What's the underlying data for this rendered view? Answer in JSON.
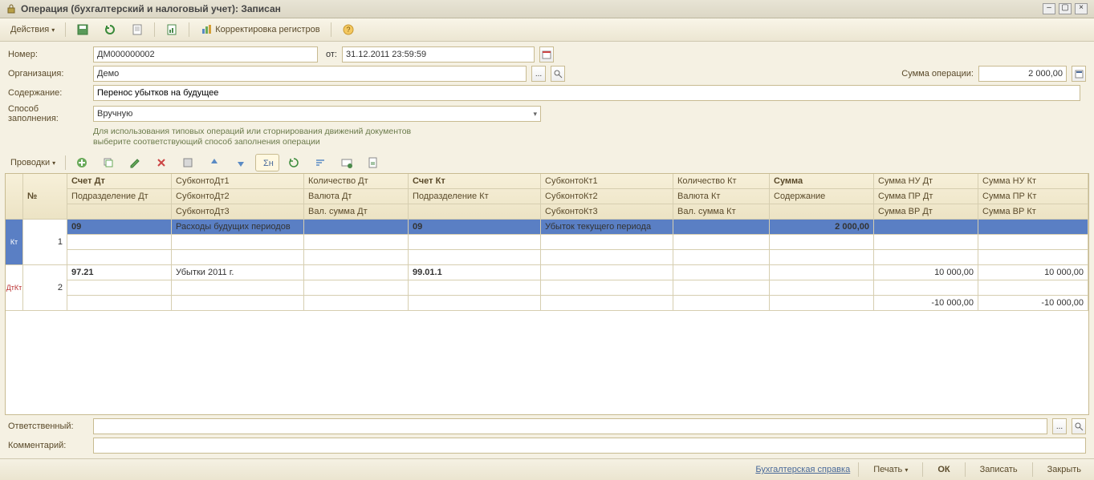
{
  "window": {
    "title": "Операция (бухгалтерский и налоговый учет): Записан"
  },
  "toolbar": {
    "actions": "Действия",
    "reg_correct": "Корректировка регистров"
  },
  "form": {
    "number_label": "Номер:",
    "number_value": "ДМ000000002",
    "date_label": "от:",
    "date_value": "31.12.2011 23:59:59",
    "org_label": "Организация:",
    "org_value": "Демо",
    "sum_label": "Сумма операции:",
    "sum_value": "2 000,00",
    "content_label": "Содержание:",
    "content_value": "Перенос убытков на будущее",
    "fill_label": "Способ заполнения:",
    "fill_value": "Вручную",
    "hint1": "Для использования типовых операций или сторнирования движений документов",
    "hint2": "выберите соответствующий способ заполнения операции"
  },
  "subtoolbar": {
    "entries": "Проводки"
  },
  "headers": {
    "num": "№",
    "acc_dt": "Счет Дт",
    "subdt1": "СубконтоДт1",
    "qty_dt": "Количество Дт",
    "acc_kt": "Счет Кт",
    "subkt1": "СубконтоКт1",
    "qty_kt": "Количество Кт",
    "sum": "Сумма",
    "nu_dt": "Сумма НУ Дт",
    "nu_kt": "Сумма НУ Кт",
    "dept_dt": "Подразделение Дт",
    "subdt2": "СубконтоДт2",
    "cur_dt": "Валюта Дт",
    "dept_kt": "Подразделение Кт",
    "subkt2": "СубконтоКт2",
    "cur_kt": "Валюта Кт",
    "content": "Содержание",
    "pr_dt": "Сумма ПР Дт",
    "pr_kt": "Сумма ПР Кт",
    "subdt3": "СубконтоДт3",
    "cursum_dt": "Вал. сумма Дт",
    "subkt3": "СубконтоКт3",
    "cursum_kt": "Вал. сумма Кт",
    "vr_dt": "Сумма ВР Дт",
    "vr_kt": "Сумма ВР Кт"
  },
  "rows": [
    {
      "marker": "Кт",
      "num": "1",
      "acc_dt": "09",
      "subdt1": "Расходы будущих периодов",
      "acc_kt": "09",
      "subkt1": "Убыток текущего периода",
      "sum": "2 000,00"
    },
    {
      "marker": "ДтКт",
      "num": "2",
      "acc_dt": "97.21",
      "subdt1": "Убытки 2011 г.",
      "acc_kt": "99.01.1",
      "nu_dt": "10 000,00",
      "nu_kt": "10 000,00",
      "vr_dt": "-10 000,00",
      "vr_kt": "-10 000,00"
    }
  ],
  "bottom": {
    "resp_label": "Ответственный:",
    "comment_label": "Комментарий:"
  },
  "footer": {
    "report": "Бухгалтерская справка",
    "print": "Печать",
    "ok": "ОК",
    "save": "Записать",
    "close": "Закрыть"
  }
}
